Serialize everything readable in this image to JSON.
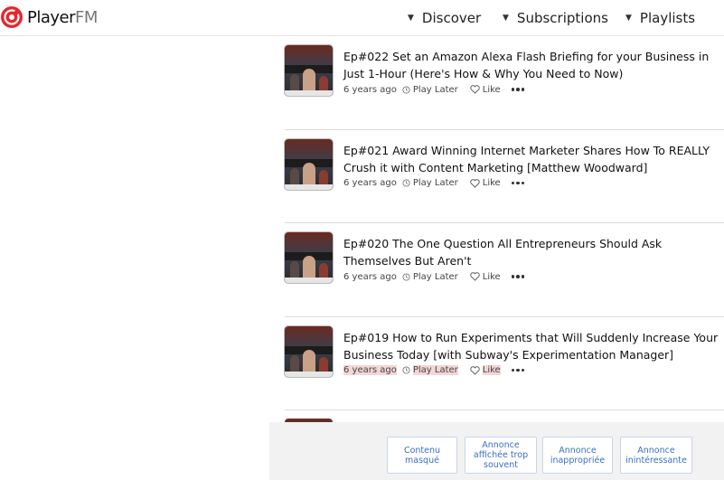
{
  "header": {
    "logo": {
      "name": "Player",
      "suffix": "FM"
    },
    "nav": [
      {
        "label": "Discover"
      },
      {
        "label": "Subscriptions"
      },
      {
        "label": "Playlists"
      }
    ]
  },
  "episodes": [
    {
      "title": "Ep#022 Set an Amazon Alexa Flash Briefing for your Business in Just 1-Hour (Here's How & Why You Need to Now)",
      "age": "6 years ago",
      "play_later": "Play Later",
      "like": "Like"
    },
    {
      "title": "Ep#021 Award Winning Internet Marketer Shares How To REALLY Crush it with Content Marketing [Matthew Woodward]",
      "age": "6 years ago",
      "play_later": "Play Later",
      "like": "Like"
    },
    {
      "title": "Ep#020 The One Question All Entrepreneurs Should Ask Themselves But Aren't",
      "age": "6 years ago",
      "play_later": "Play Later",
      "like": "Like"
    },
    {
      "title": "Ep#019 How to Run Experiments that Will Suddenly Increase Your Business Today [with Subway's Experimentation Manager]",
      "age": "6 years ago",
      "play_later": "Play Later",
      "like": "Like"
    }
  ],
  "ad_feedback": {
    "buttons": [
      {
        "label": "Contenu masqué"
      },
      {
        "label": "Annonce affichée trop souvent"
      },
      {
        "label": "Annonce inappropriée"
      },
      {
        "label": "Annonce inintéressante"
      }
    ]
  },
  "colors": {
    "brand_red": "#e8262e",
    "ad_link_blue": "#3a6fc3",
    "highlight": "#f3d6d6"
  }
}
